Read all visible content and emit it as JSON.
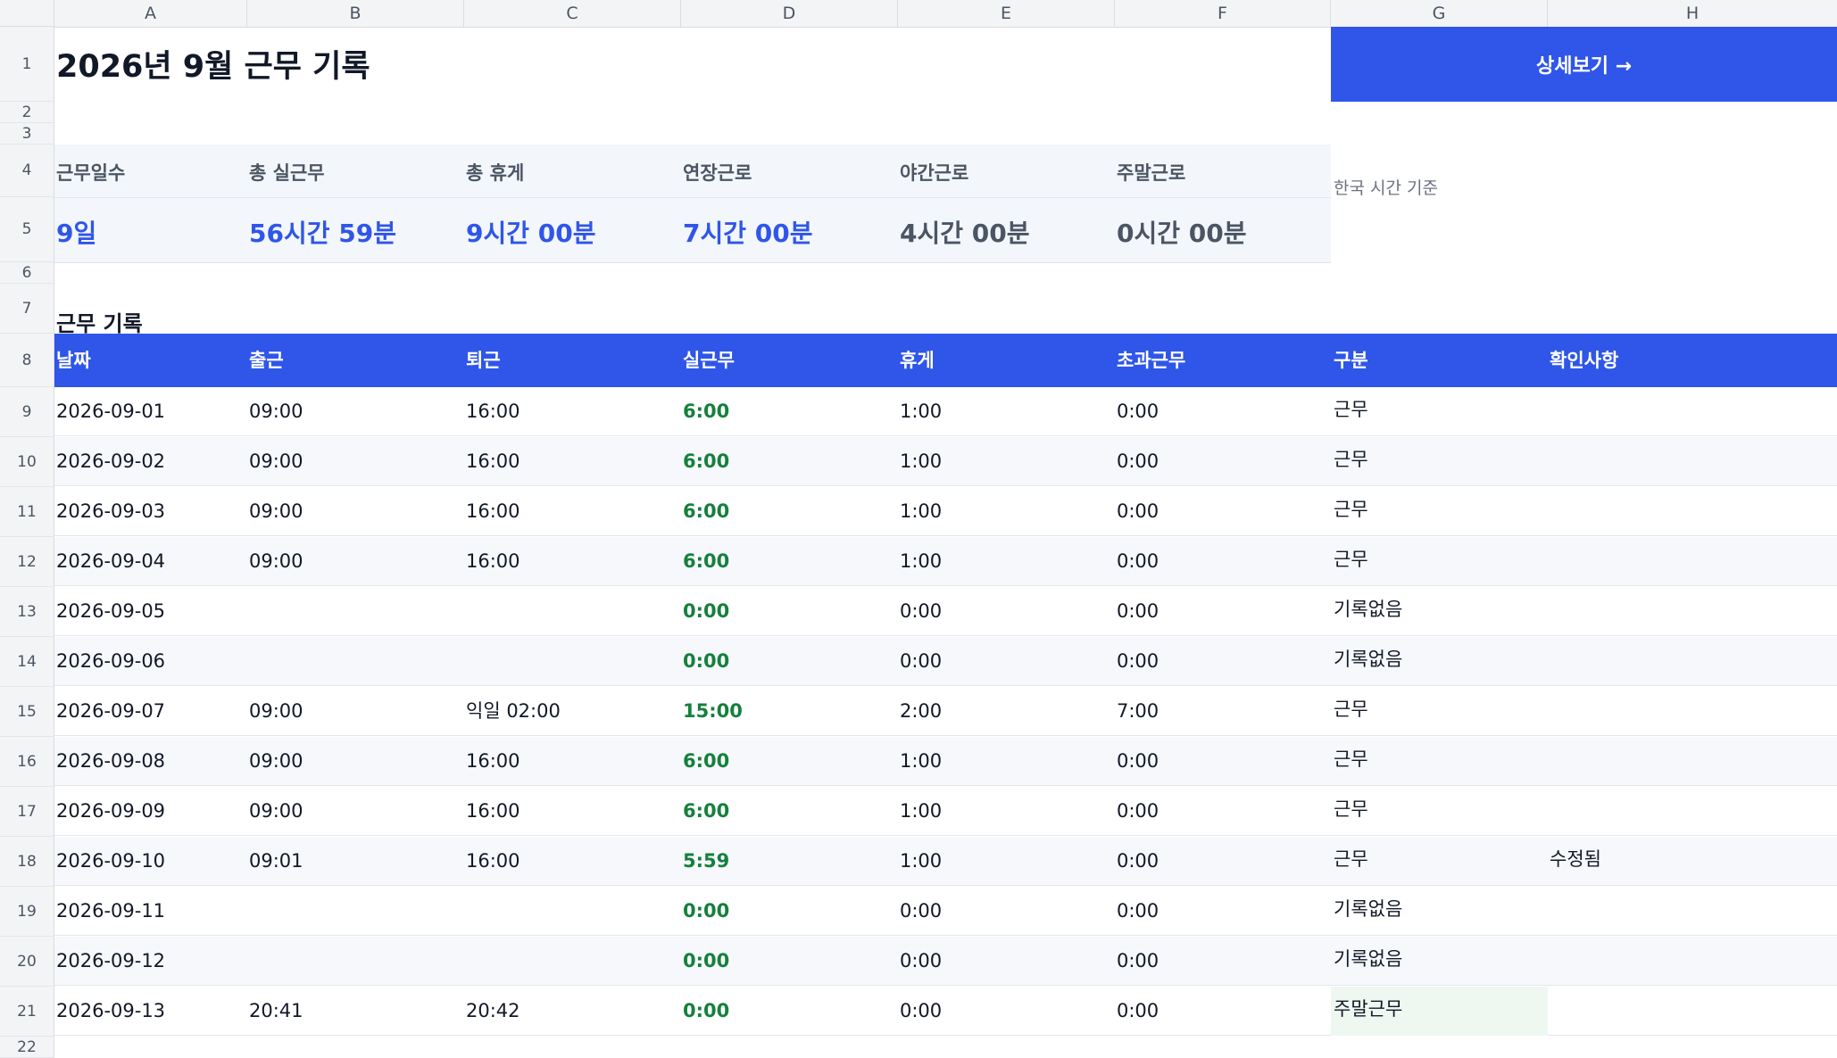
{
  "columns": [
    "A",
    "B",
    "C",
    "D",
    "E",
    "F",
    "G",
    "H"
  ],
  "rows": [
    "1",
    "2",
    "3",
    "4",
    "5",
    "6",
    "7",
    "8",
    "9",
    "10",
    "11",
    "12",
    "13",
    "14",
    "15",
    "16",
    "17",
    "18",
    "19",
    "20",
    "21",
    "22"
  ],
  "title": "2026년 9월 근무 기록",
  "detail_button": "상세보기 →",
  "timezone_note": "한국 시간 기준",
  "summary": [
    {
      "label": "근무일수",
      "value": "9일",
      "color": "#2f56e8"
    },
    {
      "label": "총 실근무",
      "value": "56시간 59분",
      "color": "#2f56e8"
    },
    {
      "label": "총 휴게",
      "value": "9시간 00분",
      "color": "#2f56e8"
    },
    {
      "label": "연장근로",
      "value": "7시간 00분",
      "color": "#2f56e8"
    },
    {
      "label": "야간근로",
      "value": "4시간 00분",
      "color": "#4b5563"
    },
    {
      "label": "주말근로",
      "value": "0시간 00분",
      "color": "#4b5563"
    }
  ],
  "section_title": "근무 기록",
  "table": {
    "headers": [
      "날짜",
      "출근",
      "퇴근",
      "실근무",
      "휴게",
      "초과근무",
      "구분",
      "확인사항"
    ],
    "rows": [
      [
        "2026-09-01",
        "09:00",
        "16:00",
        "6:00",
        "1:00",
        "0:00",
        "근무",
        ""
      ],
      [
        "2026-09-02",
        "09:00",
        "16:00",
        "6:00",
        "1:00",
        "0:00",
        "근무",
        ""
      ],
      [
        "2026-09-03",
        "09:00",
        "16:00",
        "6:00",
        "1:00",
        "0:00",
        "근무",
        ""
      ],
      [
        "2026-09-04",
        "09:00",
        "16:00",
        "6:00",
        "1:00",
        "0:00",
        "근무",
        ""
      ],
      [
        "2026-09-05",
        "",
        "",
        "0:00",
        "0:00",
        "0:00",
        "기록없음",
        ""
      ],
      [
        "2026-09-06",
        "",
        "",
        "0:00",
        "0:00",
        "0:00",
        "기록없음",
        ""
      ],
      [
        "2026-09-07",
        "09:00",
        "익일 02:00",
        "15:00",
        "2:00",
        "7:00",
        "근무",
        ""
      ],
      [
        "2026-09-08",
        "09:00",
        "16:00",
        "6:00",
        "1:00",
        "0:00",
        "근무",
        ""
      ],
      [
        "2026-09-09",
        "09:00",
        "16:00",
        "6:00",
        "1:00",
        "0:00",
        "근무",
        ""
      ],
      [
        "2026-09-10",
        "09:01",
        "16:00",
        "5:59",
        "1:00",
        "0:00",
        "근무",
        "수정됨"
      ],
      [
        "2026-09-11",
        "",
        "",
        "0:00",
        "0:00",
        "0:00",
        "기록없음",
        ""
      ],
      [
        "2026-09-12",
        "",
        "",
        "0:00",
        "0:00",
        "0:00",
        "기록없음",
        ""
      ],
      [
        "2026-09-13",
        "20:41",
        "20:42",
        "0:00",
        "0:00",
        "0:00",
        "주말근무",
        ""
      ]
    ]
  },
  "colors": {
    "accent": "#2f56e8",
    "work_time": "#15803d",
    "weekend_highlight": "#eef8f1"
  }
}
